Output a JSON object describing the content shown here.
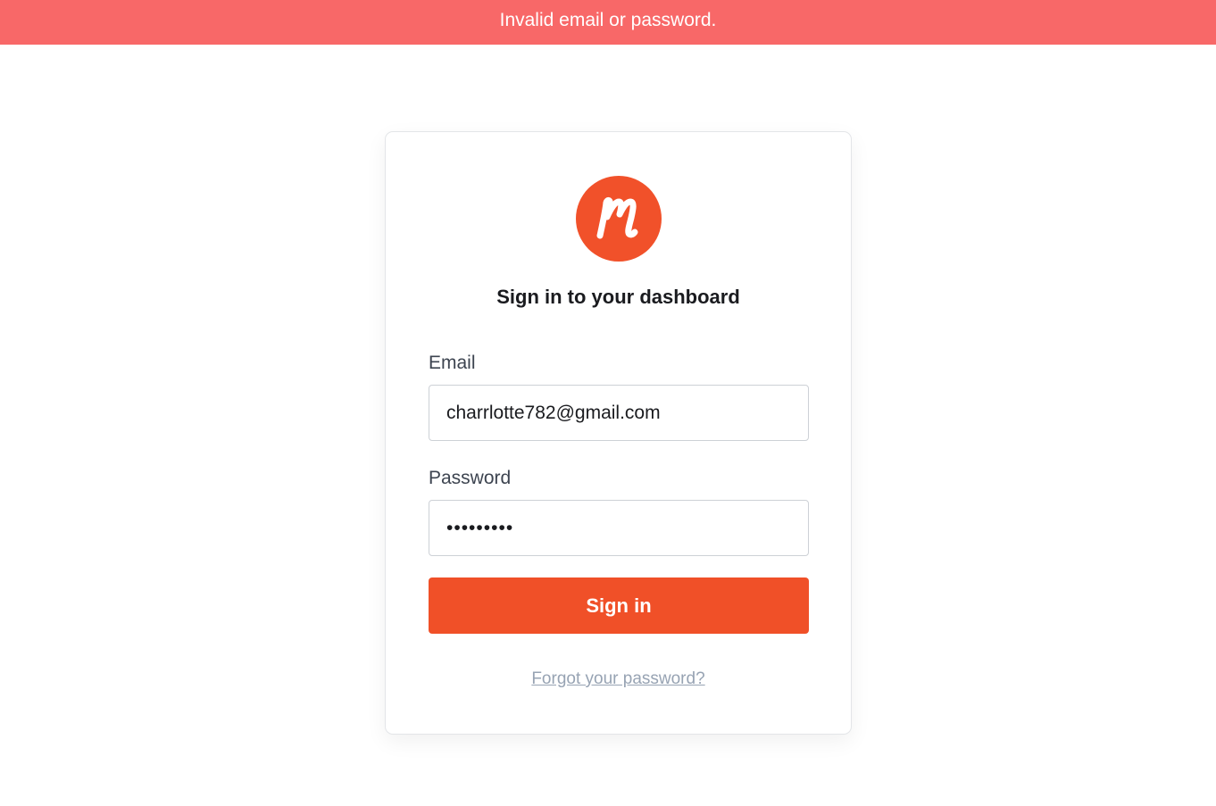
{
  "alert": {
    "message": "Invalid email or password.",
    "color": "#f86868"
  },
  "brand": {
    "logo_icon": "brand-m-logo-icon",
    "accent_color": "#f1512a"
  },
  "login": {
    "title": "Sign in to your dashboard",
    "email_label": "Email",
    "email_value": "charrlotte782@gmail.com",
    "password_label": "Password",
    "password_value": "•••••••••",
    "submit_label": "Sign in",
    "forgot_link": "Forgot your password?"
  }
}
